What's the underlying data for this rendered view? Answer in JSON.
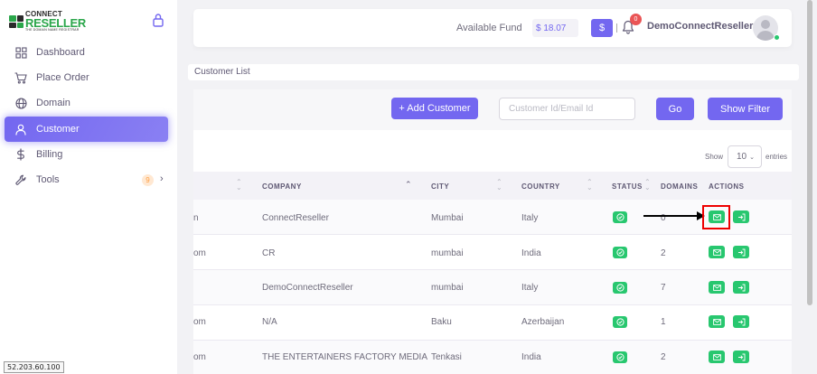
{
  "brand": {
    "top": "CONNECT",
    "main": "RESELLER",
    "sub": "THE DOMAIN NAME REGISTRAR"
  },
  "sidebar": {
    "items": [
      {
        "label": "Dashboard",
        "icon": "grid-icon"
      },
      {
        "label": "Place Order",
        "icon": "cart-icon"
      },
      {
        "label": "Domain",
        "icon": "globe-icon"
      },
      {
        "label": "Customer",
        "icon": "user-icon",
        "active": true
      },
      {
        "label": "Billing",
        "icon": "dollar-icon"
      },
      {
        "label": "Tools",
        "icon": "wrench-icon",
        "badge": "9"
      }
    ]
  },
  "header": {
    "fund_label": "Available Fund",
    "fund_value": "$ 18.07",
    "dollar_button": "$",
    "notification_count": "0",
    "username": "DemoConnectReseller"
  },
  "breadcrumb": "Customer List",
  "toolbar": {
    "add_label": "+ Add Customer",
    "search_placeholder": "Customer Id/Email Id",
    "go_label": "Go",
    "filter_label": "Show Filter"
  },
  "pagination": {
    "show_label": "Show",
    "entries_value": "10",
    "entries_label": "entries"
  },
  "table": {
    "headers": {
      "company": "COMPANY",
      "city": "CITY",
      "country": "COUNTRY",
      "status": "STATUS",
      "domains": "DOMAINS",
      "actions": "ACTIONS"
    },
    "rows": [
      {
        "email_tail": "n",
        "company": "ConnectReseller",
        "city": "Mumbai",
        "country": "Italy",
        "domains": "0"
      },
      {
        "email_tail": "om",
        "company": "CR",
        "city": "mumbai",
        "country": "India",
        "domains": "2"
      },
      {
        "email_tail": "",
        "company": "DemoConnectReseller",
        "city": "mumbai",
        "country": "Italy",
        "domains": "7"
      },
      {
        "email_tail": "om",
        "company": "N/A",
        "city": "Baku",
        "country": "Azerbaijan",
        "domains": "1"
      },
      {
        "email_tail": "om",
        "company": "THE ENTERTAINERS FACTORY MEDIA",
        "city": "Tenkasi",
        "country": "India",
        "domains": "2"
      }
    ]
  },
  "ip_address": "52.203.60.100",
  "colors": {
    "primary": "#7367f0",
    "success": "#28c76f",
    "danger": "#ea5455",
    "warning": "#ff9f43"
  }
}
